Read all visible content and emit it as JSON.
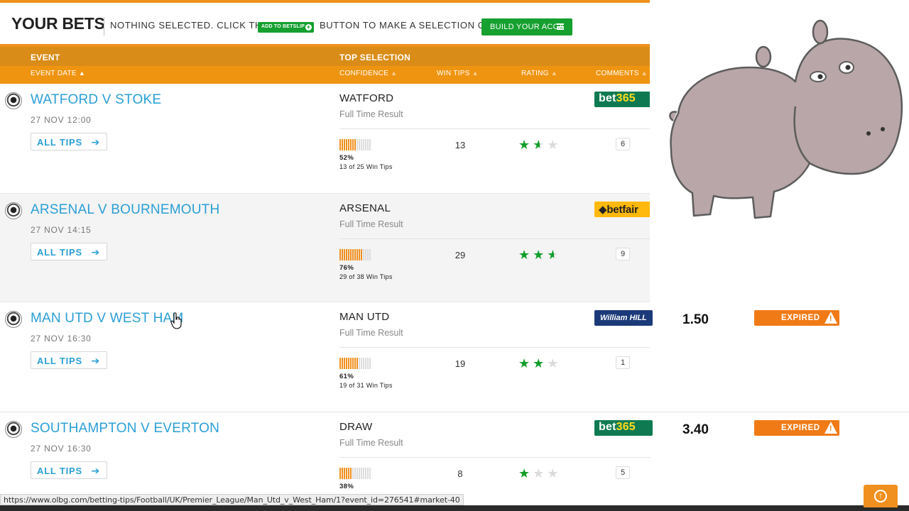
{
  "your_bets": {
    "title": "YOUR BETS",
    "text_before": "NOTHING SELECTED. CLICK THE",
    "add_button_label": "ADD TO BETSLIP",
    "text_after": "BUTTON TO MAKE A SELECTION OR",
    "acca_button_label": "BUILD YOUR ACCA"
  },
  "table_header": {
    "event": "EVENT",
    "event_date": "EVENT DATE",
    "top_selection": "TOP SELECTION",
    "confidence": "CONFIDENCE",
    "win_tips": "WIN TIPS",
    "rating": "RATING",
    "comments": "COMMENTS"
  },
  "events": [
    {
      "name": "WATFORD V STOKE",
      "date": "27 NOV 12:00",
      "all_tips": "ALL TIPS",
      "selection": "WATFORD",
      "market": "Full Time Result",
      "confidence_pct": "52%",
      "confidence_value": 0.52,
      "confidence_sub": "13 of 25 Win Tips",
      "win_tips": "13",
      "rating": 1.5,
      "comments": "6",
      "bookmaker": "bet365",
      "odds": "",
      "status": ""
    },
    {
      "name": "ARSENAL V BOURNEMOUTH",
      "date": "27 NOV 14:15",
      "all_tips": "ALL TIPS",
      "selection": "ARSENAL",
      "market": "Full Time Result",
      "confidence_pct": "76%",
      "confidence_value": 0.76,
      "confidence_sub": "29 of 38 Win Tips",
      "win_tips": "29",
      "rating": 2.5,
      "comments": "9",
      "bookmaker": "betfair",
      "odds": "",
      "status": ""
    },
    {
      "name": "MAN UTD V WEST HAM",
      "date": "27 NOV 16:30",
      "all_tips": "ALL TIPS",
      "selection": "MAN UTD",
      "market": "Full Time Result",
      "confidence_pct": "61%",
      "confidence_value": 0.61,
      "confidence_sub": "19 of 31 Win Tips",
      "win_tips": "19",
      "rating": 2,
      "comments": "1",
      "bookmaker": "William HILL",
      "odds": "1.50",
      "status": "EXPIRED"
    },
    {
      "name": "SOUTHAMPTON V EVERTON",
      "date": "27 NOV 16:30",
      "all_tips": "ALL TIPS",
      "selection": "DRAW",
      "market": "Full Time Result",
      "confidence_pct": "38%",
      "confidence_value": 0.38,
      "confidence_sub": "",
      "win_tips": "8",
      "rating": 1,
      "comments": "5",
      "bookmaker": "bet365",
      "odds": "3.40",
      "status": "EXPIRED"
    }
  ],
  "status_bar": {
    "url": "https://www.olbg.com/betting-tips/Football/UK/Premier_League/Man_Utd_v_West_Ham/1?event_id=276541#market-40"
  },
  "icons": {
    "scroll_top": "arrow-up-circle-icon",
    "event": "football-icon",
    "all_tips": "chevron-right-icon",
    "expired": "warning-icon"
  },
  "colors": {
    "accent_orange": "#f0901e",
    "header_dark_orange": "#d98c17",
    "link_blue": "#2a9fd6",
    "star_green": "#139e2c",
    "button_green": "#16a02f",
    "expired_orange": "#f07b16"
  }
}
